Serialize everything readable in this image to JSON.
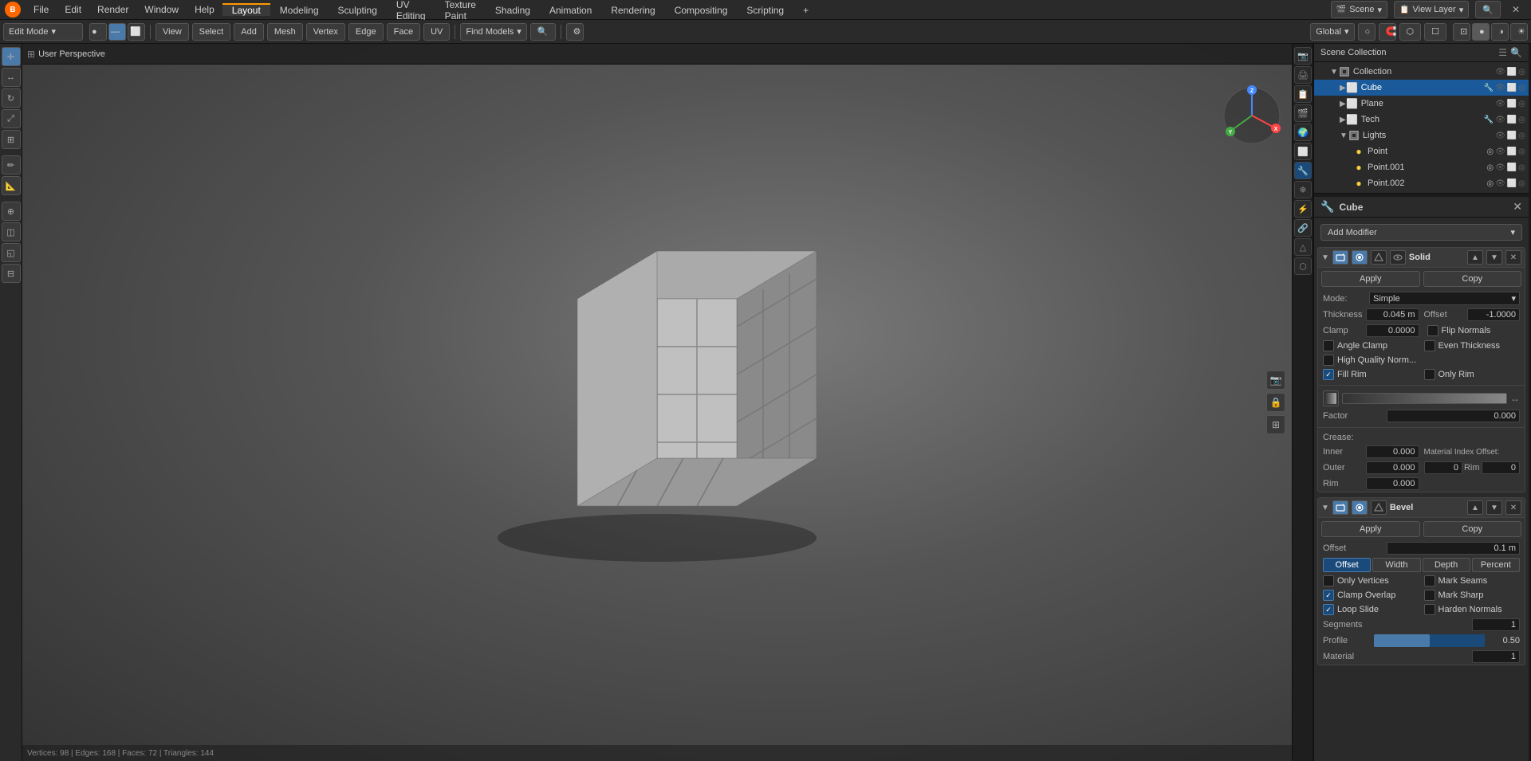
{
  "topMenuBar": {
    "menus": [
      "File",
      "Edit",
      "Render",
      "Window",
      "Help"
    ],
    "tabs": [
      {
        "label": "Layout",
        "active": true
      },
      {
        "label": "Modeling",
        "active": false
      },
      {
        "label": "Sculpting",
        "active": false
      },
      {
        "label": "UV Editing",
        "active": false
      },
      {
        "label": "Texture Paint",
        "active": false
      },
      {
        "label": "Shading",
        "active": false
      },
      {
        "label": "Animation",
        "active": false
      },
      {
        "label": "Rendering",
        "active": false
      },
      {
        "label": "Compositing",
        "active": false
      },
      {
        "label": "Scripting",
        "active": false
      }
    ],
    "plus_icon": "+",
    "scene_name": "Scene",
    "view_layer": "View Layer"
  },
  "toolbar": {
    "mode": "Edit Mode",
    "view_btn": "View",
    "select_btn": "Select",
    "add_btn": "Add",
    "mesh_btn": "Mesh",
    "vertex_btn": "Vertex",
    "edge_btn": "Edge",
    "face_btn": "Face",
    "uv_btn": "UV",
    "find_models": "Find Models",
    "transform": "Global"
  },
  "viewport": {
    "gizmo": {
      "x_color": "#ff4444",
      "y_color": "#44ff44",
      "z_color": "#4444ff"
    }
  },
  "outliner": {
    "title": "Scene Collection",
    "items": [
      {
        "label": "Collection",
        "type": "collection",
        "indent": 1,
        "expanded": true
      },
      {
        "label": "Cube",
        "type": "mesh",
        "indent": 2,
        "selected": true,
        "active": true
      },
      {
        "label": "Plane",
        "type": "mesh",
        "indent": 2,
        "selected": false
      },
      {
        "label": "Tech",
        "type": "mesh",
        "indent": 2,
        "selected": false
      },
      {
        "label": "Lights",
        "type": "collection",
        "indent": 2,
        "selected": false,
        "expanded": true
      },
      {
        "label": "Point",
        "type": "light",
        "indent": 3,
        "selected": false
      },
      {
        "label": "Point.001",
        "type": "light",
        "indent": 3,
        "selected": false
      },
      {
        "label": "Point.002",
        "type": "light",
        "indent": 3,
        "selected": false
      }
    ]
  },
  "propertiesPanel": {
    "object_name": "Cube",
    "add_modifier_label": "Add Modifier",
    "modifiers": [
      {
        "name": "Solid",
        "apply_label": "Apply",
        "copy_label": "Copy",
        "fields": {
          "mode_label": "Mode:",
          "mode_value": "Simple",
          "thickness_label": "Thickness",
          "thickness_value": "0.045 m",
          "offset_label": "Offset",
          "offset_value": "-1.0000",
          "clamp_label": "Clamp",
          "clamp_value": "0.0000",
          "flip_normals_label": "Flip Normals",
          "flip_normals_checked": false,
          "angle_clamp_label": "Angle Clamp",
          "angle_clamp_checked": false,
          "even_thickness_label": "Even Thickness",
          "even_thickness_checked": false,
          "high_quality_label": "High Quality Norm...",
          "high_quality_checked": false,
          "fill_rim_label": "Fill Rim",
          "fill_rim_checked": true,
          "only_rim_label": "Only Rim",
          "only_rim_checked": false,
          "factor_label": "Factor",
          "factor_value": "0.000",
          "crease_label": "Crease:",
          "inner_label": "Inner",
          "inner_value": "0.000",
          "outer_label": "Outer",
          "outer_value": "0.000",
          "rim_label": "Rim",
          "rim_value": "0.000",
          "material_index_label": "Material Index Offset:",
          "material_index_main": "0",
          "rim_mi_label": "Rim",
          "rim_mi_value": "0"
        }
      },
      {
        "name": "Bevel",
        "apply_label": "Apply",
        "copy_label": "Copy",
        "fields": {
          "offset_label": "Offset",
          "offset_value": "0.1 m",
          "tabs": [
            "Offset",
            "Width",
            "Depth",
            "Percent"
          ],
          "active_tab": "Offset",
          "only_vertices_label": "Only Vertices",
          "only_vertices_checked": false,
          "clamp_overlap_label": "Clamp Overlap",
          "clamp_overlap_checked": true,
          "loop_slide_label": "Loop Slide",
          "loop_slide_checked": true,
          "mark_seams_label": "Mark Seams",
          "mark_seams_checked": false,
          "mark_sharp_label": "Mark Sharp",
          "mark_sharp_checked": false,
          "harden_normals_label": "Harden Normals",
          "harden_normals_checked": false,
          "segments_label": "Segments",
          "segments_value": "1",
          "profile_label": "Profile",
          "profile_value": "0.50",
          "material_label": "Material",
          "material_value": "1"
        }
      }
    ]
  },
  "icons": {
    "triangle_right": "▶",
    "triangle_down": "▼",
    "cube": "⬜",
    "circle": "●",
    "wrench": "🔧",
    "camera": "📷",
    "sphere": "○",
    "close": "✕",
    "chevron_down": "▾",
    "eye": "👁",
    "lock": "🔒",
    "filter": "☰",
    "dot": "•",
    "arrow_lr": "↔",
    "check": "✓"
  }
}
